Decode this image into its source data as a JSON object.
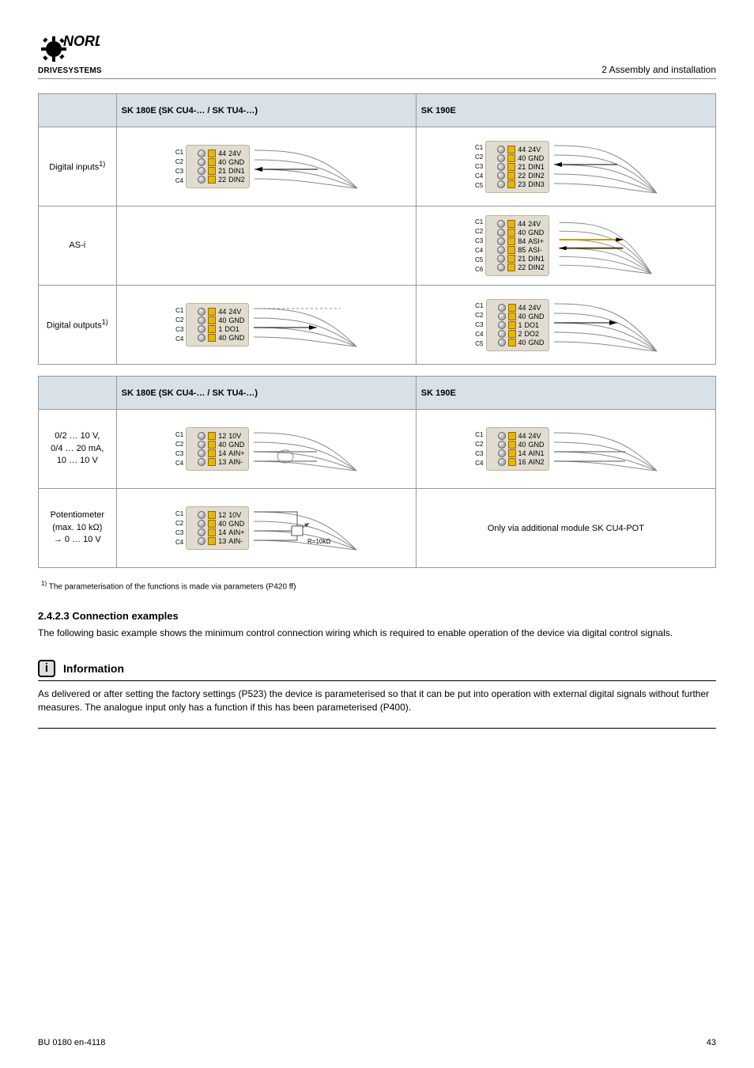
{
  "header": {
    "brand_logo_text": "NORD",
    "brand_sub": "DRIVESYSTEMS",
    "section": "2 Assembly and installation"
  },
  "table1": {
    "headers": [
      "",
      "SK 180E (SK CU4-… / SK TU4-…)",
      "SK 190E"
    ],
    "rows": [
      {
        "c0": "Digital inputs",
        "sk180e": {
          "terminals": [
            "C1",
            "C2",
            "C3",
            "C4"
          ],
          "pins": [
            {
              "n": "44",
              "lbl": "24V"
            },
            {
              "n": "40",
              "lbl": "GND"
            },
            {
              "n": "21",
              "lbl": "DIN1"
            },
            {
              "n": "22",
              "lbl": "DIN2"
            }
          ],
          "arrow_in": true
        },
        "sk190e": {
          "terminals": [
            "C1",
            "C2",
            "C3",
            "C4",
            "C5"
          ],
          "pins": [
            {
              "n": "44",
              "lbl": "24V"
            },
            {
              "n": "40",
              "lbl": "GND"
            },
            {
              "n": "21",
              "lbl": "DIN1"
            },
            {
              "n": "22",
              "lbl": "DIN2"
            },
            {
              "n": "23",
              "lbl": "DIN3"
            }
          ],
          "arrow_in": true
        }
      },
      {
        "c0": "AS-i",
        "sk180e": {
          "empty": true
        },
        "sk190e": {
          "terminals": [
            "C1",
            "C2",
            "C3",
            "C4",
            "C5",
            "C6"
          ],
          "pins": [
            {
              "n": "44",
              "lbl": "24V"
            },
            {
              "n": "40",
              "lbl": "GND"
            },
            {
              "n": "84",
              "lbl": "ASI+"
            },
            {
              "n": "85",
              "lbl": "ASI-"
            },
            {
              "n": "21",
              "lbl": "DIN1"
            },
            {
              "n": "22",
              "lbl": "DIN2"
            }
          ],
          "asi": true
        }
      },
      {
        "c0": "Digital outputs",
        "sk180e": {
          "terminals": [
            "C1",
            "C2",
            "C3",
            "C4"
          ],
          "pins": [
            {
              "n": "44",
              "lbl": "24V"
            },
            {
              "n": "40",
              "lbl": "GND"
            },
            {
              "n": "1",
              "lbl": "DO1"
            },
            {
              "n": "40",
              "lbl": "GND"
            }
          ],
          "arrow_out": true,
          "dashed_top": true
        },
        "sk190e": {
          "terminals": [
            "C1",
            "C2",
            "C3",
            "C4",
            "C5"
          ],
          "pins": [
            {
              "n": "44",
              "lbl": "24V"
            },
            {
              "n": "40",
              "lbl": "GND"
            },
            {
              "n": "1",
              "lbl": "DO1"
            },
            {
              "n": "2",
              "lbl": "DO2"
            },
            {
              "n": "40",
              "lbl": "GND"
            }
          ],
          "arrow_out": true
        }
      }
    ]
  },
  "table2": {
    "headers": [
      "",
      "SK 180E (SK CU4-… / SK TU4-…)",
      "SK 190E"
    ],
    "rows": [
      {
        "c0_lines": [
          "0/2 … 10 V,",
          "0/4 … 20 mA,",
          " 10 … 10 V"
        ],
        "sk180e": {
          "terminals": [
            "C1",
            "C2",
            "C3",
            "C4"
          ],
          "pins": [
            {
              "n": "12",
              "lbl": "10V"
            },
            {
              "n": "40",
              "lbl": "GND"
            },
            {
              "n": "14",
              "lbl": "AIN+"
            },
            {
              "n": "13",
              "lbl": "AIN-"
            }
          ],
          "ain_pair": true
        },
        "sk190e": {
          "terminals": [
            "C1",
            "C2",
            "C3",
            "C4"
          ],
          "pins": [
            {
              "n": "44",
              "lbl": "24V"
            },
            {
              "n": "40",
              "lbl": "GND"
            },
            {
              "n": "14",
              "lbl": "AIN1"
            },
            {
              "n": "16",
              "lbl": "AIN2"
            }
          ],
          "ain_plain": true
        }
      },
      {
        "c0": "Potentiometer",
        "c0_lines": [
          "(max. 10 kΩ)",
          "→ 0 … 10 V"
        ],
        "sk180e": {
          "terminals": [
            "C1",
            "C2",
            "C3",
            "C4"
          ],
          "pins": [
            {
              "n": "12",
              "lbl": "10V"
            },
            {
              "n": "40",
              "lbl": "GND"
            },
            {
              "n": "14",
              "lbl": "AIN+"
            },
            {
              "n": "13",
              "lbl": "AIN-"
            }
          ],
          "pot": true,
          "pot_label": "R=10kΩ"
        },
        "sk190e": {
          "text": "Only via additional module SK CU4-POT"
        }
      }
    ]
  },
  "footnote": {
    "num": "1)",
    "text": "The parameterisation of the functions is made via parameters (P420 ff)"
  },
  "heading5": "2.4.2.3 Connection examples",
  "para": "The following basic example shows the minimum control connection wiring which is required to enable operation of the device via digital control signals.",
  "info": {
    "title": "Information",
    "body": "As delivered or after setting the factory settings (P523) the device is parameterised so that it can be put into operation with external digital signals without further measures. The analogue input only has a function if this has been parameterised (P400)."
  },
  "footer": {
    "left": "BU 0180 en-4118",
    "right": "43"
  }
}
